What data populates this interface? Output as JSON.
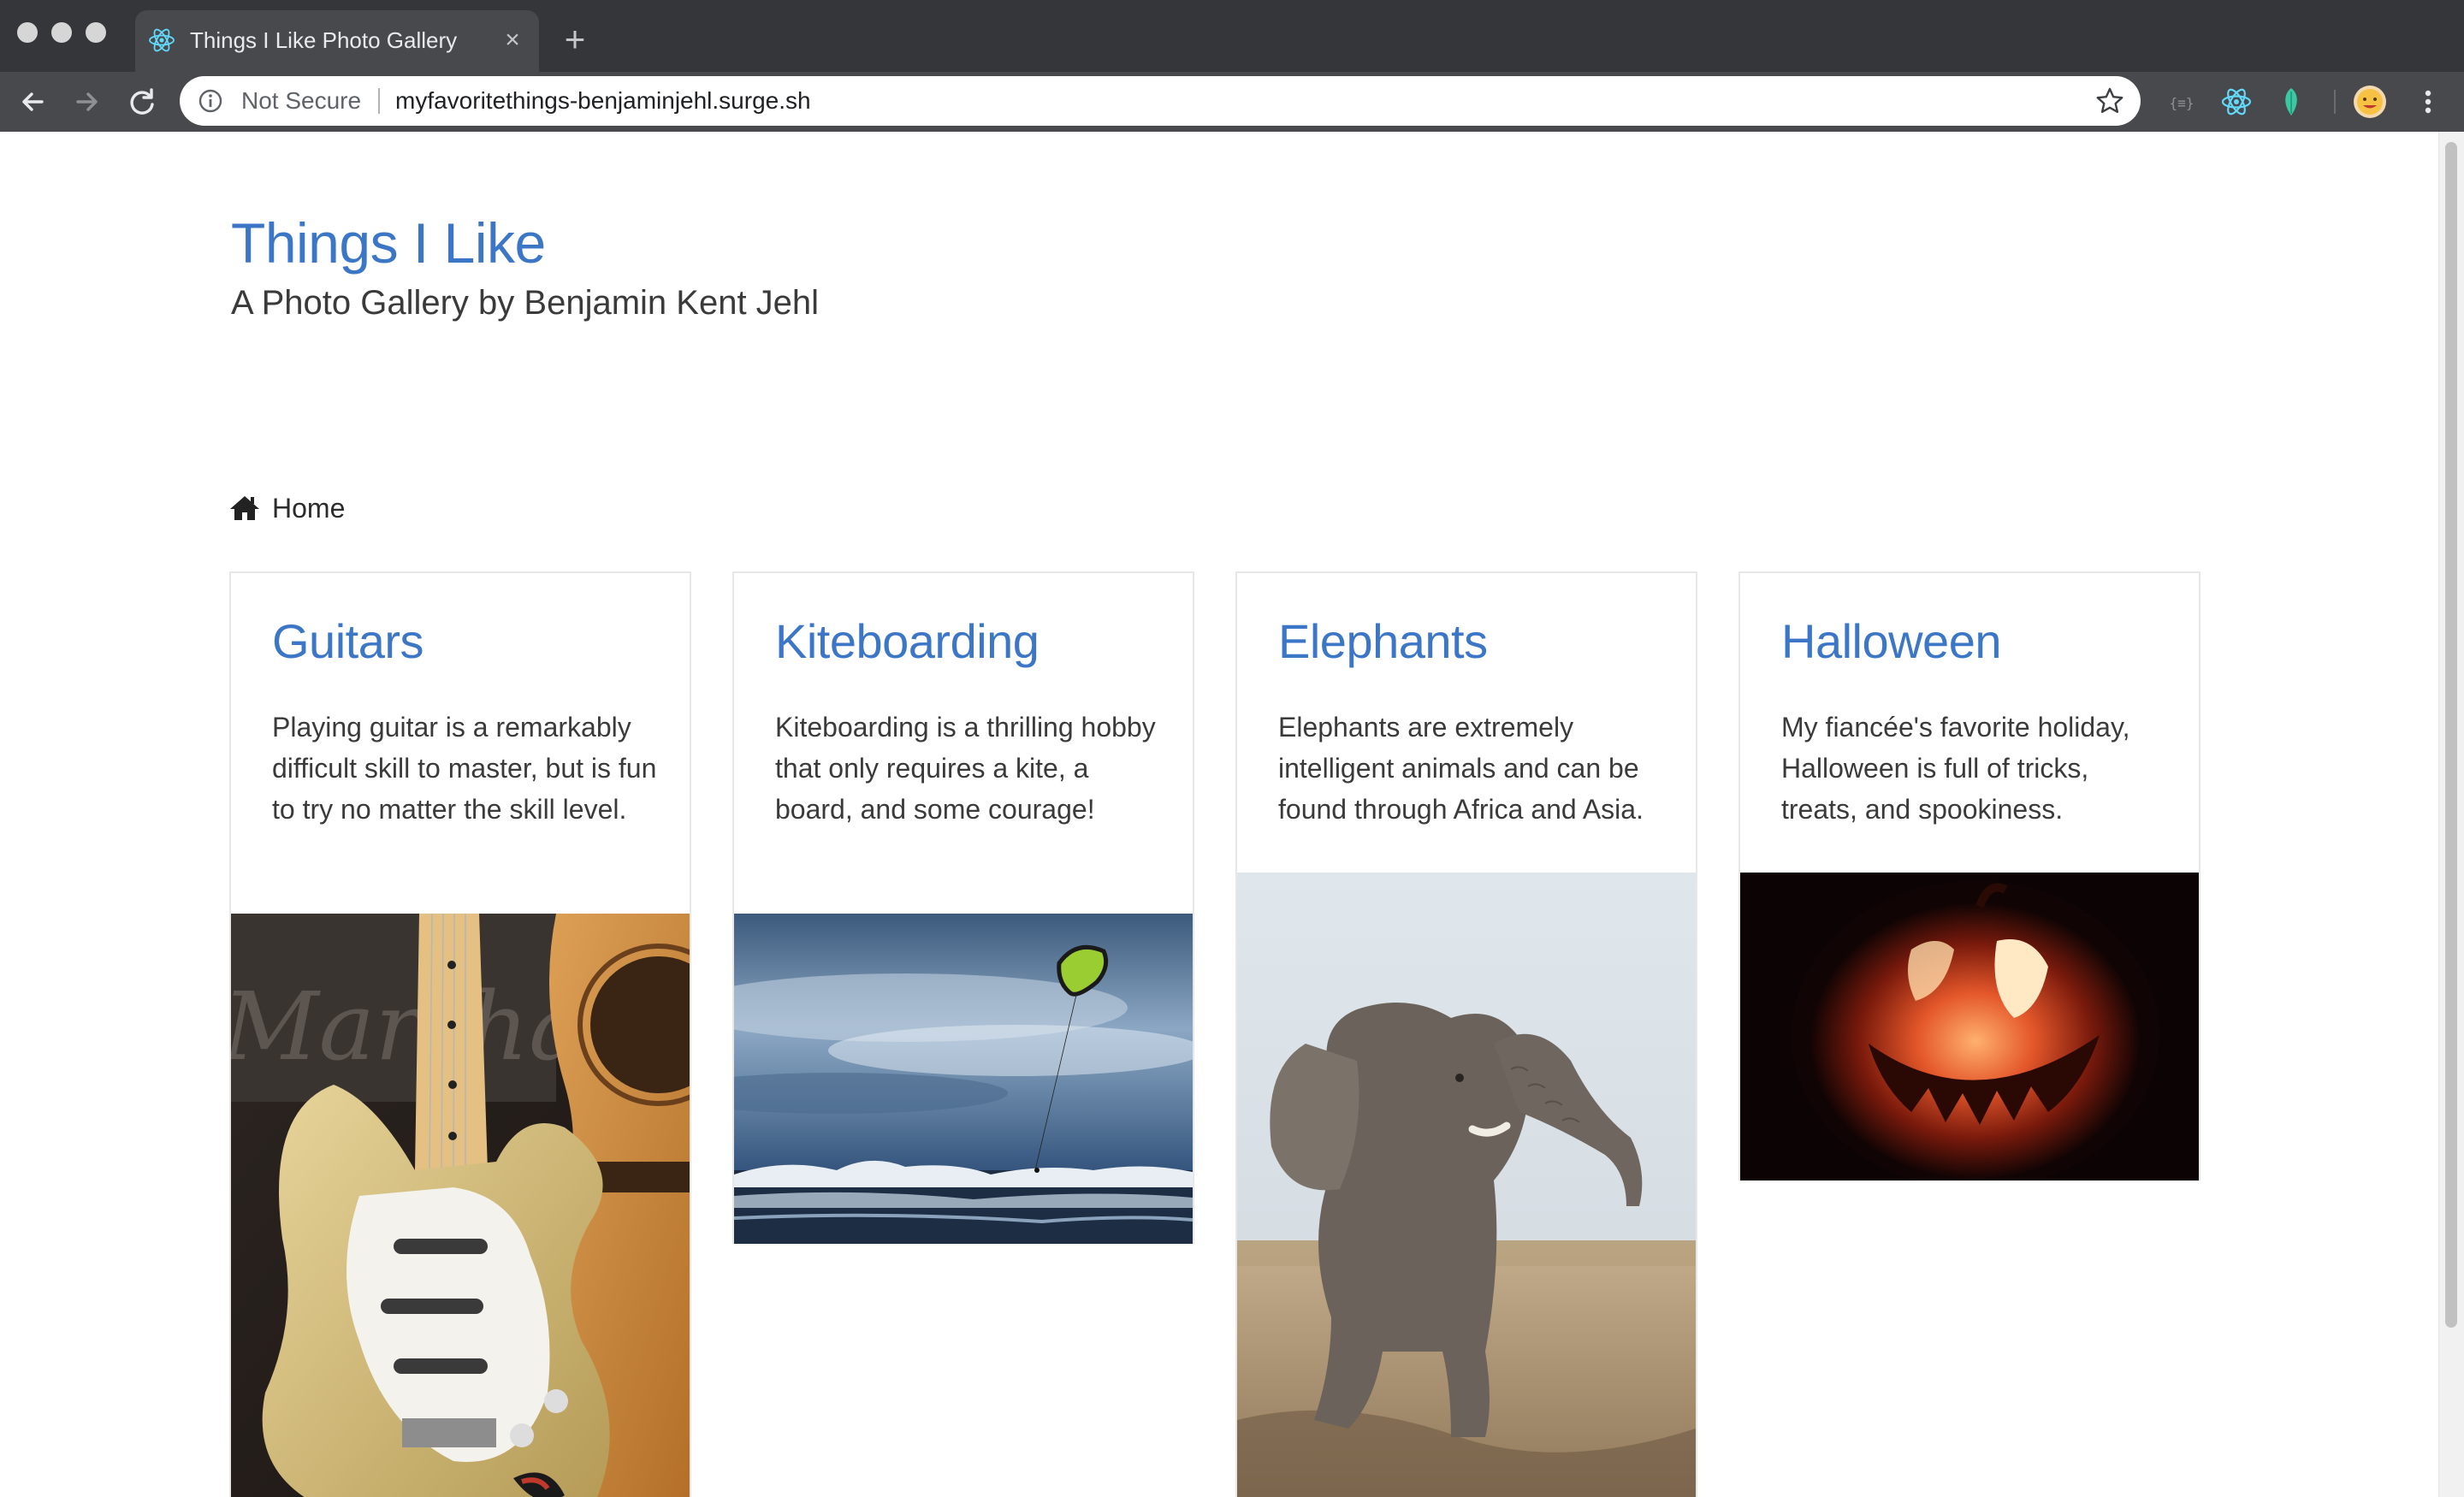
{
  "browser": {
    "tab_title": "Things I Like Photo Gallery",
    "tab_close": "×",
    "new_tab": "+",
    "security_label": "Not Secure",
    "url": "myfavoritethings-benjaminjehl.surge.sh",
    "accent": "#3c76c7"
  },
  "header": {
    "title": "Things I Like",
    "subtitle": "A Photo Gallery by Benjamin Kent Jehl"
  },
  "breadcrumb": {
    "home_label": "Home",
    "icon": "home-icon"
  },
  "cards": [
    {
      "title": "Guitars",
      "text": "Playing guitar is a remarkably difficult skill to master, but is fun to try no matter the skill level.",
      "image": "guitar-photo"
    },
    {
      "title": "Kiteboarding",
      "text": "Kiteboarding is a thrilling hobby that only requires a kite, a board, and some courage!",
      "image": "kiteboarding-photo"
    },
    {
      "title": "Elephants",
      "text": "Elephants are extremely intelligent animals and can be found through Africa and Asia.",
      "image": "elephant-photo"
    },
    {
      "title": "Halloween",
      "text": "My fiancée's favorite holiday, Halloween is full of tricks, treats, and spookiness.",
      "image": "jack-o-lantern-photo"
    }
  ]
}
